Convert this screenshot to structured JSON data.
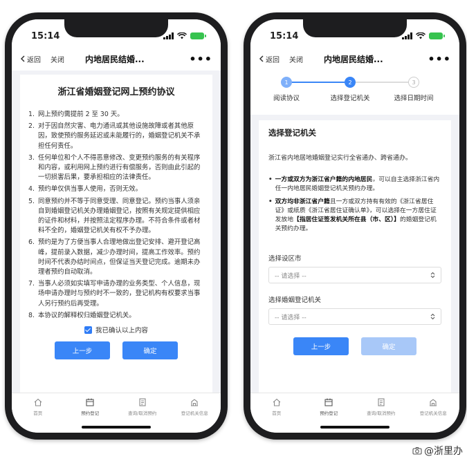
{
  "status": {
    "time": "15:14"
  },
  "nav": {
    "back": "返回",
    "close": "关闭",
    "title": "内地居民结婚..."
  },
  "tabs": [
    {
      "label": "首页"
    },
    {
      "label": "预约登记"
    },
    {
      "label": "查询/取消预约"
    },
    {
      "label": "登记机关信息"
    }
  ],
  "agreement": {
    "title": "浙江省婚姻登记网上预约协议",
    "items": [
      {
        "num": "1.",
        "text": "网上预约需提前 2 至 30 天。"
      },
      {
        "num": "2.",
        "text": "对于因自然灾害、电力通讯或其他设施故障或者其他原因，致使预约服务延迟或未能履行的，婚姻登记机关不承担任何责任。"
      },
      {
        "num": "3.",
        "text": "任何单位和个人不得恶意修改、变更预约服务的有关程序和内容，或利用网上预约进行有偿服务，否则由此引起的一切损害后果，要承担相应的法律责任。"
      },
      {
        "num": "4.",
        "text": "预约单仅供当事人使用，否则无效。"
      },
      {
        "num": "5.",
        "text": "同意预约并不等于同意受理、同意登记。预约当事人须亲自到婚姻登记机关办理婚姻登记，按照有关规定提供相应的证件和材料，并按照法定程序办理。不符合条件或者材料不全的，婚姻登记机关有权不予办理。"
      },
      {
        "num": "6.",
        "text": "预约是为了方便当事人合理地做出登记安排、避开登记高峰，提前录入数据，减少办理时间，提高工作效率。预约时间不代表办结时间点，但保证当天登记完成。逾期未办理者预约自动取消。"
      },
      {
        "num": "7.",
        "text": "当事人必须如实填写申请办理的业务类型、个人信息，现场申请办理时与预约时不一致的，登记机构有权要求当事人另行预约后再受理。"
      },
      {
        "num": "8.",
        "text": "本协议的解释权归婚姻登记机关。"
      }
    ],
    "confirm": "我已确认以上内容",
    "prev": "上一步",
    "ok": "确定"
  },
  "steps": [
    {
      "num": "1",
      "label": "阅读协议"
    },
    {
      "num": "2",
      "label": "选择登记机关"
    },
    {
      "num": "3",
      "label": "选择日期时间"
    }
  ],
  "select_org": {
    "title": "选择登记机关",
    "intro": "浙江省内地居地婚姻登记实行全省通办、跨省通办。",
    "bullet1_bold": "一方或双方为浙江省户籍的内地居民",
    "bullet1_rest": "，可以自主选择浙江省内任一内地居民婚姻登记机关预约办理。",
    "bullet2_bold1": "双方均非浙江省户籍",
    "bullet2_mid": "且一方或双方持有有效的《浙江省居住证》或纸质《浙江省居住证确认单》，可以选择在一方居住证发放地",
    "bullet2_bold2": "【指居住证签发机关所在县（市、区）】",
    "bullet2_rest": "的婚姻登记机关预约办理。",
    "city_label": "选择设区市",
    "city_value": "-- 请选择 --",
    "org_label": "选择婚姻登记机关",
    "org_value": "-- 请选择 --",
    "prev": "上一步",
    "ok": "确定"
  },
  "watermark": "@浙里办"
}
